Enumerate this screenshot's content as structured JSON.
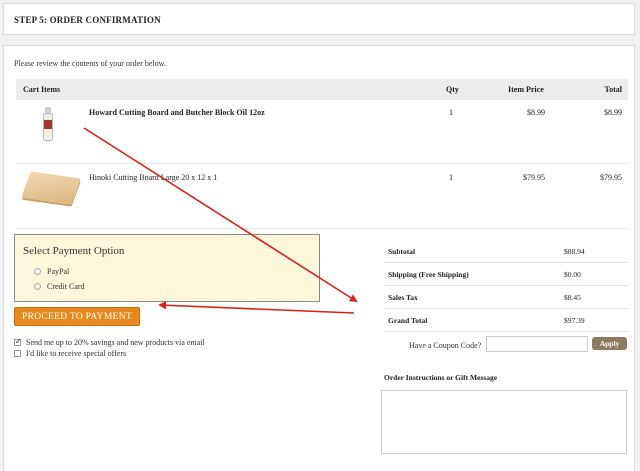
{
  "step_title": "STEP 5: ORDER CONFIRMATION",
  "intro": "Please review the contents of your order below.",
  "cart": {
    "headers": {
      "items": "Cart Items",
      "qty": "Qty",
      "price": "Item Price",
      "total": "Total"
    },
    "rows": [
      {
        "name": "Howard Cutting Board and Butcher Block Oil 12oz",
        "qty": "1",
        "price": "$8.99",
        "total": "$8.99"
      },
      {
        "name": "Hinoki Cutting Board Large 20 x 12 x 1",
        "qty": "1",
        "price": "$79.95",
        "total": "$79.95"
      }
    ]
  },
  "payment": {
    "title": "Select Payment Option",
    "options": [
      "PayPal",
      "Credit Card"
    ],
    "proceed_label": "PROCEED TO PAYMENT"
  },
  "checks": [
    {
      "label": "Send me up to 20% savings and new products via email",
      "checked": true
    },
    {
      "label": "I'd like to receive special offers",
      "checked": false
    }
  ],
  "totals": [
    {
      "label": "Subtotal",
      "value": "$88.94"
    },
    {
      "label": "Shipping (Free Shipping)",
      "value": "$0.00"
    },
    {
      "label": "Sales Tax",
      "value": "$8.45"
    },
    {
      "label": "Grand Total",
      "value": "$97.39"
    }
  ],
  "coupon": {
    "label": "Have a Coupon Code?",
    "value": "",
    "apply_label": "Apply"
  },
  "instructions": {
    "label": "Order Instructions or Gift Message",
    "value": ""
  },
  "colors": {
    "accent": "#e8891f",
    "payment_bg": "#fdf8dc",
    "annotation": "#d9201c",
    "apply_bg": "#8d7a63"
  }
}
